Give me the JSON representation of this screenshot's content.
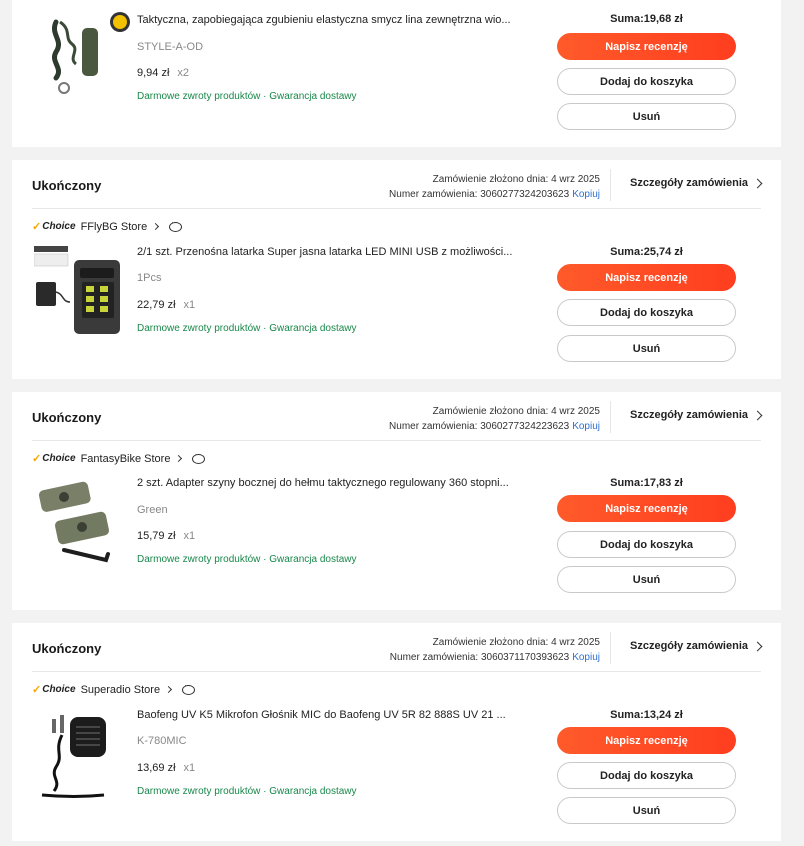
{
  "labels": {
    "sum_prefix": "Suma:",
    "write_review": "Napisz recenzję",
    "add_to_cart": "Dodaj do koszyka",
    "remove": "Usuń",
    "order_details": "Szczegóły zamówienia",
    "copy": "Kopiuj",
    "choice": "Choice",
    "notes": "Darmowe zwroty produktów · Gwarancja dostawy"
  },
  "colors": {
    "accent": "#ff4a26",
    "note_green": "#18884a",
    "link_blue": "#2e6fd3"
  },
  "orders": [
    {
      "product": {
        "title": "Taktyczna, zapobiegająca zgubieniu elastyczna smycz lina zewnętrzna wio...",
        "variant": "STYLE-A-OD",
        "price": "9,94 zł",
        "qty": "x2",
        "sum": "Suma:19,68 zł",
        "image": "tactical-lanyard-image"
      }
    },
    {
      "status": "Ukończony",
      "placed_line": "Zamówienie złożono dnia: 4 wrz 2025",
      "number_line": "Numer zamówienia: 3060277324203623",
      "store": "FFlyBG Store",
      "product": {
        "title": "2/1 szt. Przenośna latarka Super jasna latarka LED MINI USB z możliwości...",
        "variant": "1Pcs",
        "price": "22,79 zł",
        "qty": "x1",
        "sum": "Suma:25,74 zł",
        "image": "led-flashlight-image"
      }
    },
    {
      "status": "Ukończony",
      "placed_line": "Zamówienie złożono dnia: 4 wrz 2025",
      "number_line": "Numer zamówienia: 3060277324223623",
      "store": "FantasyBike Store",
      "product": {
        "title": "2 szt. Adapter szyny bocznej do hełmu taktycznego regulowany 360 stopni...",
        "variant": "Green",
        "price": "15,79 zł",
        "qty": "x1",
        "sum": "Suma:17,83 zł",
        "image": "helmet-rail-adapter-image"
      }
    },
    {
      "status": "Ukończony",
      "placed_line": "Zamówienie złożono dnia: 4 wrz 2025",
      "number_line": "Numer zamówienia: 3060371170393623",
      "store": "Superadio Store",
      "product": {
        "title": "Baofeng UV K5 Mikrofon Głośnik MIC do Baofeng UV 5R 82 888S UV 21 ...",
        "variant": "K-780MIC",
        "price": "13,69 zł",
        "qty": "x1",
        "sum": "Suma:13,24 zł",
        "image": "speaker-mic-image"
      }
    }
  ]
}
